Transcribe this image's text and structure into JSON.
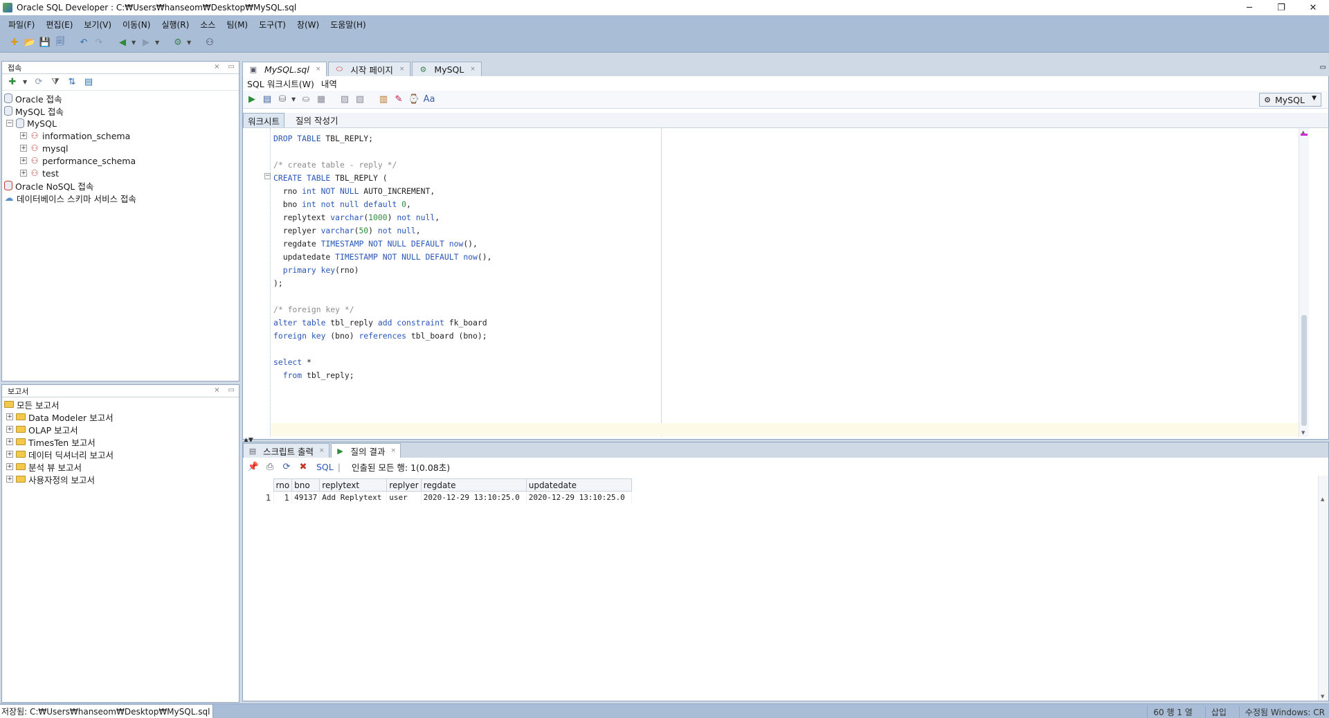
{
  "window": {
    "title": "Oracle SQL Developer : C:₩Users₩hanseom₩Desktop₩MySQL.sql",
    "minimize": "─",
    "restore": "❐",
    "close": "✕"
  },
  "menu": [
    "파일(F)",
    "편집(E)",
    "보기(V)",
    "이동(N)",
    "실행(R)",
    "소스",
    "팀(M)",
    "도구(T)",
    "창(W)",
    "도움말(H)"
  ],
  "toolbar_icons": [
    "new-icon",
    "open-icon",
    "save-icon",
    "save-all-icon",
    "undo-icon",
    "redo-icon",
    "back-icon",
    "forward-icon",
    "migrate-icon",
    "binoculars-icon"
  ],
  "connections_panel": {
    "title": "접속",
    "items": [
      {
        "label": "Oracle 접속",
        "level": 0,
        "icon": "db-icon"
      },
      {
        "label": "MySQL 접속",
        "level": 0,
        "icon": "db-icon"
      },
      {
        "label": "MySQL",
        "level": 1,
        "icon": "connection-icon",
        "expanded": true
      },
      {
        "label": "information_schema",
        "level": 2,
        "icon": "schema-icon"
      },
      {
        "label": "mysql",
        "level": 2,
        "icon": "schema-icon"
      },
      {
        "label": "performance_schema",
        "level": 2,
        "icon": "schema-icon"
      },
      {
        "label": "test",
        "level": 2,
        "icon": "schema-icon"
      },
      {
        "label": "Oracle NoSQL 접속",
        "level": 0,
        "icon": "db-icon"
      },
      {
        "label": "데이터베이스 스키마 서비스 접속",
        "level": 0,
        "icon": "cloud-icon"
      }
    ]
  },
  "reports_panel": {
    "title": "보고서",
    "items": [
      {
        "label": "모든 보고서",
        "level": 0
      },
      {
        "label": "Data Modeler 보고서",
        "level": 1
      },
      {
        "label": "OLAP 보고서",
        "level": 1
      },
      {
        "label": "TimesTen 보고서",
        "level": 1
      },
      {
        "label": "데이터 딕셔너리 보고서",
        "level": 1
      },
      {
        "label": "분석 뷰 보고서",
        "level": 1
      },
      {
        "label": "사용자정의 보고서",
        "level": 1
      }
    ]
  },
  "doc_tabs": [
    {
      "label": "MySQL.sql",
      "active": true
    },
    {
      "label": "시작 페이지",
      "active": false
    },
    {
      "label": "MySQL",
      "active": false
    }
  ],
  "sub_tabs": [
    "SQL 워크시트(W)",
    "내역"
  ],
  "connection_select": "MySQL",
  "worksheet_tabs": [
    "워크시트",
    "질의 작성기"
  ],
  "result_tabs": [
    {
      "label": "스크립트 출력",
      "active": false
    },
    {
      "label": "질의 결과",
      "active": true
    }
  ],
  "result_toolbar": {
    "sql_label": "SQL",
    "message": "인출된 모든 행: 1(0.08초)"
  },
  "result_grid": {
    "columns": [
      "rno",
      "bno",
      "replytext",
      "replyer",
      "regdate",
      "updatedate"
    ],
    "rows": [
      {
        "num": "1",
        "rno": "1",
        "bno": "49137",
        "replytext": "Add Replytext",
        "replyer": "user",
        "regdate": "2020-12-29 13:10:25.0",
        "updatedate": "2020-12-29 13:10:25.0"
      }
    ]
  },
  "status": {
    "path": "저장됨: C:₩Users₩hanseom₩Desktop₩MySQL.sql",
    "position": "60 행 1 열",
    "mode": "삽입",
    "modified": "수정됨 Windows: CR"
  },
  "colors": {
    "chrome": "#a9bed6",
    "keyword": "#2a56b8",
    "comment": "#8c8c8c"
  }
}
